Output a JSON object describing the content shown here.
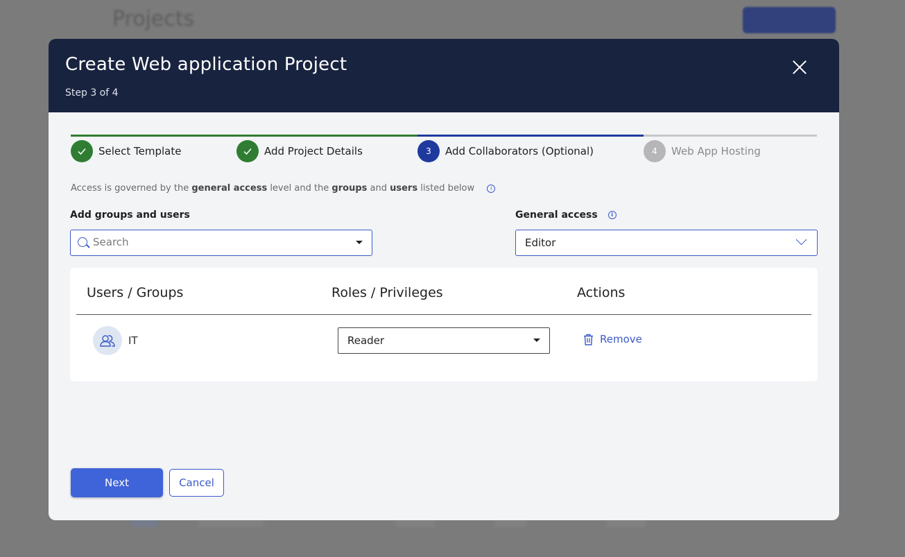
{
  "background": {
    "page_title": "Projects"
  },
  "modal": {
    "title": "Create Web application Project",
    "step_text": "Step 3 of 4",
    "close_icon": "close-icon"
  },
  "stepper": {
    "steps": [
      {
        "number": "1",
        "label": "Select Template",
        "status": "done"
      },
      {
        "number": "2",
        "label": "Add Project Details",
        "status": "done"
      },
      {
        "number": "3",
        "label": "Add Collaborators (Optional)",
        "status": "active"
      },
      {
        "number": "4",
        "label": "Web App Hosting",
        "status": "pending"
      }
    ]
  },
  "info": {
    "part1": "Access is governed by the ",
    "bold1": "general access",
    "part2": " level and the ",
    "bold2": "groups",
    "part3": " and ",
    "bold3": "users",
    "part4": " listed below"
  },
  "add_groups": {
    "label": "Add groups and users",
    "placeholder": "Search"
  },
  "general_access": {
    "label": "General access",
    "value": "Editor"
  },
  "table": {
    "headers": [
      "Users / Groups",
      "Roles / Privileges",
      "Actions"
    ],
    "rows": [
      {
        "name": "IT",
        "role": "Reader",
        "action": "Remove"
      }
    ]
  },
  "buttons": {
    "next": "Next",
    "cancel": "Cancel"
  },
  "colors": {
    "header_bg": "#18233f",
    "accent": "#3f63d8",
    "done": "#2f7d32",
    "active": "#1f3a9e"
  }
}
